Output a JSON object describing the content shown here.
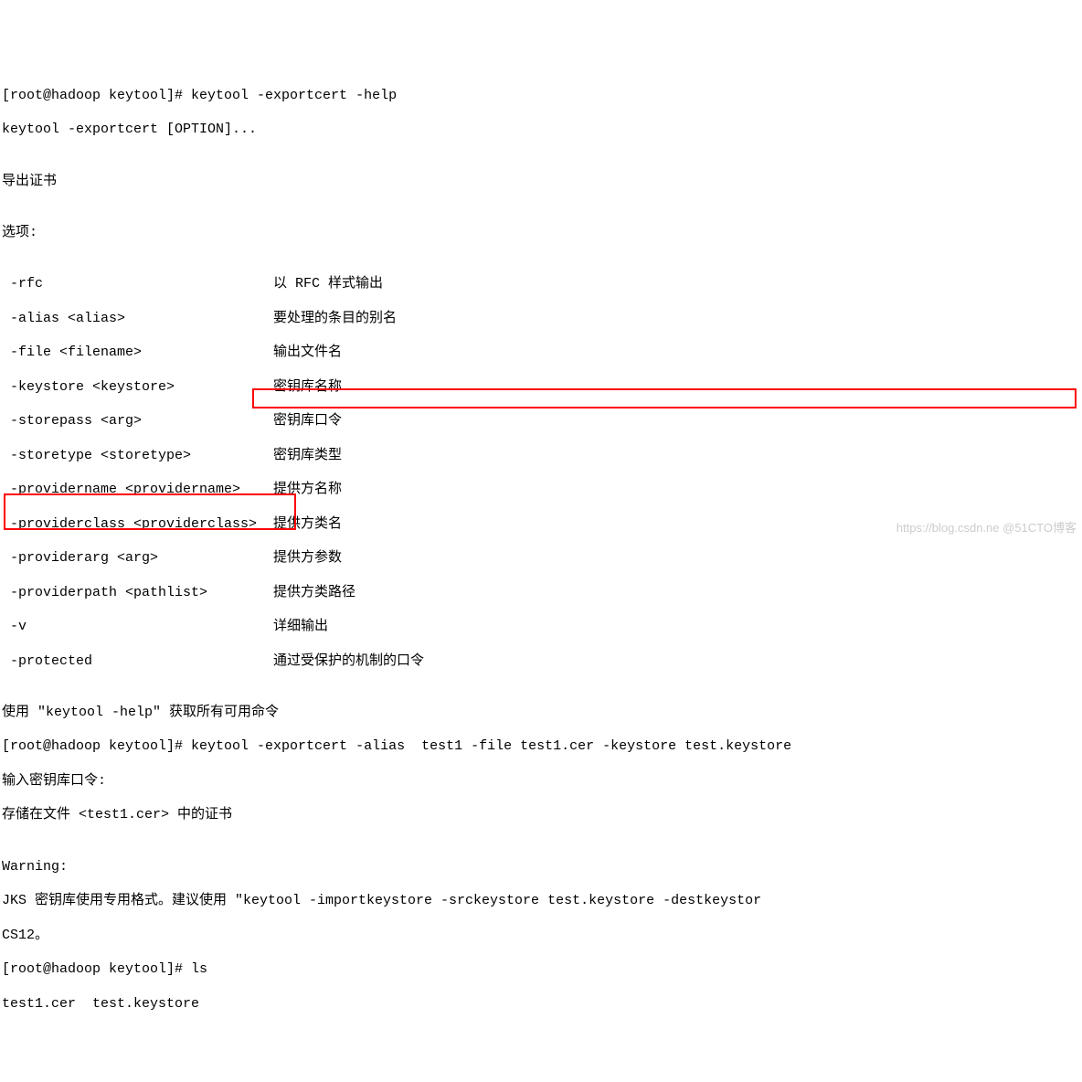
{
  "lines": {
    "l0": "[root@hadoop keytool]# keytool -exportcert -help",
    "l1": "keytool -exportcert [OPTION]...",
    "l2": "",
    "l3": "导出证书",
    "l4": "",
    "l5": "选项:",
    "l6": "",
    "l7": " -rfc                            以 RFC 样式输出",
    "l8": " -alias <alias>                  要处理的条目的别名",
    "l9": " -file <filename>                输出文件名",
    "l10": " -keystore <keystore>            密钥库名称",
    "l11": " -storepass <arg>                密钥库口令",
    "l12": " -storetype <storetype>          密钥库类型",
    "l13": " -providername <providername>    提供方名称",
    "l14": " -providerclass <providerclass>  提供方类名",
    "l15": " -providerarg <arg>              提供方参数",
    "l16": " -providerpath <pathlist>        提供方类路径",
    "l17": " -v                              详细输出",
    "l18": " -protected                      通过受保护的机制的口令",
    "l19": "",
    "l20": "使用 \"keytool -help\" 获取所有可用命令",
    "l21": "[root@hadoop keytool]# keytool -exportcert -alias  test1 -file test1.cer -keystore test.keystore",
    "l22": "输入密钥库口令:",
    "l23": "存储在文件 <test1.cer> 中的证书",
    "l24": "",
    "l25": "Warning:",
    "l26": "JKS 密钥库使用专用格式。建议使用 \"keytool -importkeystore -srckeystore test.keystore -destkeystor",
    "l27": "CS12。",
    "l28": "[root@hadoop keytool]# ls",
    "l29": "test1.cer  test.keystore"
  },
  "watermark": "https://blog.csdn.ne @51CTO博客"
}
